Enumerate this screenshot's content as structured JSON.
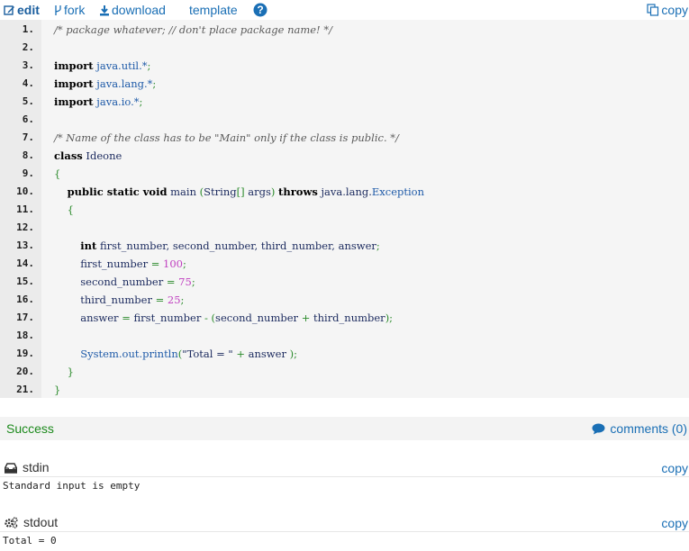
{
  "toolbar": {
    "edit_label": "edit",
    "fork_label": "fork",
    "download_label": "download",
    "template_label": "template",
    "help_icon": "question-circle-icon",
    "copy_label": "copy"
  },
  "code": {
    "lines": [
      {
        "n": "1.",
        "tokens": [
          [
            "comment",
            "/* package whatever; // don't place package name! */"
          ]
        ]
      },
      {
        "n": "2.",
        "tokens": []
      },
      {
        "n": "3.",
        "tokens": [
          [
            "kw",
            "import"
          ],
          [
            "id",
            " "
          ],
          [
            "pkg",
            "java.util.*"
          ],
          [
            "punct",
            ";"
          ]
        ]
      },
      {
        "n": "4.",
        "tokens": [
          [
            "kw",
            "import"
          ],
          [
            "id",
            " "
          ],
          [
            "pkg",
            "java.lang.*"
          ],
          [
            "punct",
            ";"
          ]
        ]
      },
      {
        "n": "5.",
        "tokens": [
          [
            "kw",
            "import"
          ],
          [
            "id",
            " "
          ],
          [
            "pkg",
            "java.io.*"
          ],
          [
            "punct",
            ";"
          ]
        ]
      },
      {
        "n": "6.",
        "tokens": []
      },
      {
        "n": "7.",
        "tokens": [
          [
            "comment",
            "/* Name of the class has to be \"Main\" only if the class is public. */"
          ]
        ]
      },
      {
        "n": "8.",
        "tokens": [
          [
            "kw",
            "class"
          ],
          [
            "id",
            " Ideone"
          ]
        ]
      },
      {
        "n": "9.",
        "tokens": [
          [
            "punct",
            "{"
          ]
        ]
      },
      {
        "n": "10.",
        "tokens": [
          [
            "id",
            "    "
          ],
          [
            "kw",
            "public static void"
          ],
          [
            "id",
            " main "
          ],
          [
            "punct",
            "("
          ],
          [
            "id",
            "String"
          ],
          [
            "punct",
            "[]"
          ],
          [
            "id",
            " args"
          ],
          [
            "punct",
            ")"
          ],
          [
            "id",
            " "
          ],
          [
            "kw",
            "throws"
          ],
          [
            "id",
            " java.lang."
          ],
          [
            "pkg",
            "Exception"
          ]
        ]
      },
      {
        "n": "11.",
        "tokens": [
          [
            "id",
            "    "
          ],
          [
            "punct",
            "{"
          ]
        ]
      },
      {
        "n": "12.",
        "tokens": []
      },
      {
        "n": "13.",
        "tokens": [
          [
            "id",
            "        "
          ],
          [
            "kw",
            "int"
          ],
          [
            "id",
            " first_number, second_number, third_number, answer"
          ],
          [
            "punct",
            ";"
          ]
        ]
      },
      {
        "n": "14.",
        "tokens": [
          [
            "id",
            "        first_number "
          ],
          [
            "op",
            "="
          ],
          [
            "id",
            " "
          ],
          [
            "num",
            "100"
          ],
          [
            "punct",
            ";"
          ]
        ]
      },
      {
        "n": "15.",
        "tokens": [
          [
            "id",
            "        second_number "
          ],
          [
            "op",
            "="
          ],
          [
            "id",
            " "
          ],
          [
            "num",
            "75"
          ],
          [
            "punct",
            ";"
          ]
        ]
      },
      {
        "n": "16.",
        "tokens": [
          [
            "id",
            "        third_number "
          ],
          [
            "op",
            "="
          ],
          [
            "id",
            " "
          ],
          [
            "num",
            "25"
          ],
          [
            "punct",
            ";"
          ]
        ]
      },
      {
        "n": "17.",
        "tokens": [
          [
            "id",
            "        answer "
          ],
          [
            "op",
            "="
          ],
          [
            "id",
            " first_number "
          ],
          [
            "op",
            "-"
          ],
          [
            "id",
            " "
          ],
          [
            "punct",
            "("
          ],
          [
            "id",
            "second_number "
          ],
          [
            "op",
            "+"
          ],
          [
            "id",
            " third_number"
          ],
          [
            "punct",
            ");"
          ]
        ]
      },
      {
        "n": "18.",
        "tokens": []
      },
      {
        "n": "19.",
        "tokens": [
          [
            "id",
            "        "
          ],
          [
            "pkg",
            "System.out.println"
          ],
          [
            "punct",
            "("
          ],
          [
            "str",
            "\"Total = \""
          ],
          [
            "id",
            " "
          ],
          [
            "op",
            "+"
          ],
          [
            "id",
            " answer "
          ],
          [
            "punct",
            ");"
          ]
        ]
      },
      {
        "n": "20.",
        "tokens": [
          [
            "id",
            "    "
          ],
          [
            "punct",
            "}"
          ]
        ]
      },
      {
        "n": "21.",
        "tokens": [
          [
            "punct",
            "}"
          ]
        ]
      }
    ]
  },
  "result": {
    "status": "Success",
    "comments_label": "comments (0)"
  },
  "stdin": {
    "title": "stdin",
    "copy_label": "copy",
    "content": "Standard input is empty"
  },
  "stdout": {
    "title": "stdout",
    "copy_label": "copy",
    "content": "Total = 0"
  },
  "colors": {
    "link": "#1a6fb5",
    "success": "#1d8a1d",
    "code_bg": "#f5f5f5",
    "gutter_bg": "#ebebeb",
    "keyword": "#000000",
    "number": "#c040c0",
    "comment": "#5a5a5a"
  }
}
